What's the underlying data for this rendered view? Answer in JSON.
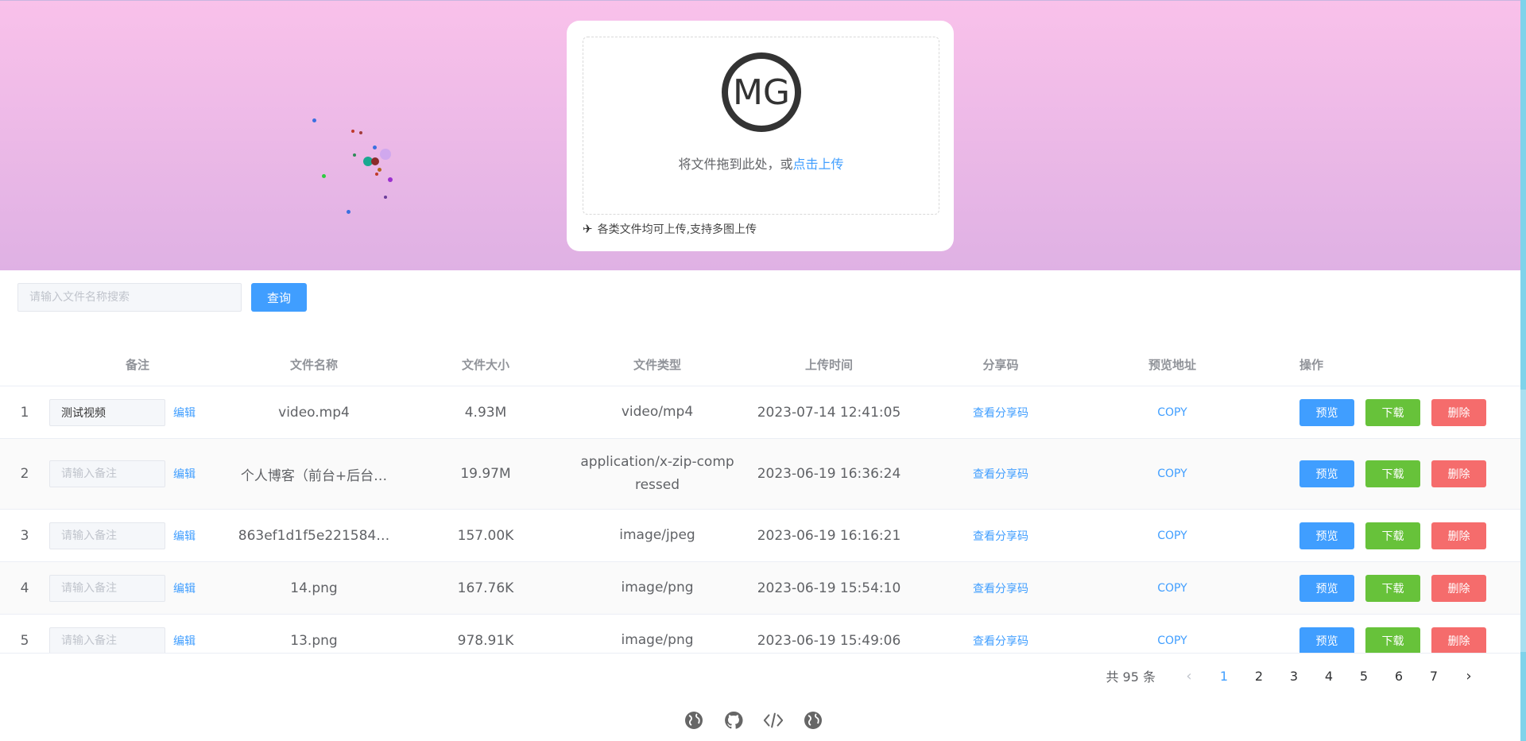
{
  "upload": {
    "drop_text": "将文件拖到此处，或",
    "click_upload": "点击上传",
    "tip": "各类文件均可上传,支持多图上传",
    "logo_text": "MG"
  },
  "search": {
    "placeholder": "请输入文件名称搜索",
    "button": "查询"
  },
  "table": {
    "headers": {
      "note": "备注",
      "name": "文件名称",
      "size": "文件大小",
      "type": "文件类型",
      "time": "上传时间",
      "share": "分享码",
      "preview_url": "预览地址",
      "ops": "操作"
    },
    "note_placeholder": "请输入备注",
    "edit_label": "编辑",
    "share_label": "查看分享码",
    "copy_label": "COPY",
    "op_preview": "预览",
    "op_download": "下载",
    "op_delete": "删除",
    "rows": [
      {
        "idx": "1",
        "note": "测试视频",
        "name": "video.mp4",
        "size": "4.93M",
        "type": "video/mp4",
        "time": "2023-07-14 12:41:05"
      },
      {
        "idx": "2",
        "note": "",
        "name": "个人博客（前台+后台…",
        "size": "19.97M",
        "type": "application/x-zip-compressed",
        "time": "2023-06-19 16:36:24"
      },
      {
        "idx": "3",
        "note": "",
        "name": "863ef1d1f5e221584…",
        "size": "157.00K",
        "type": "image/jpeg",
        "time": "2023-06-19 16:16:21"
      },
      {
        "idx": "4",
        "note": "",
        "name": "14.png",
        "size": "167.76K",
        "type": "image/png",
        "time": "2023-06-19 15:54:10"
      },
      {
        "idx": "5",
        "note": "",
        "name": "13.png",
        "size": "978.91K",
        "type": "image/png",
        "time": "2023-06-19 15:49:06"
      }
    ]
  },
  "pagination": {
    "total": "共 95 条",
    "pages": [
      "1",
      "2",
      "3",
      "4",
      "5",
      "6",
      "7"
    ],
    "current": "1"
  },
  "footer": {
    "icons": [
      "globe-icon",
      "github-icon",
      "code-icon",
      "globe-icon"
    ]
  },
  "colors": {
    "primary": "#409eff",
    "success": "#67c23a",
    "danger": "#f56c6c",
    "hero_top": "#f9c1ea",
    "hero_bottom": "#dfb1e4"
  }
}
